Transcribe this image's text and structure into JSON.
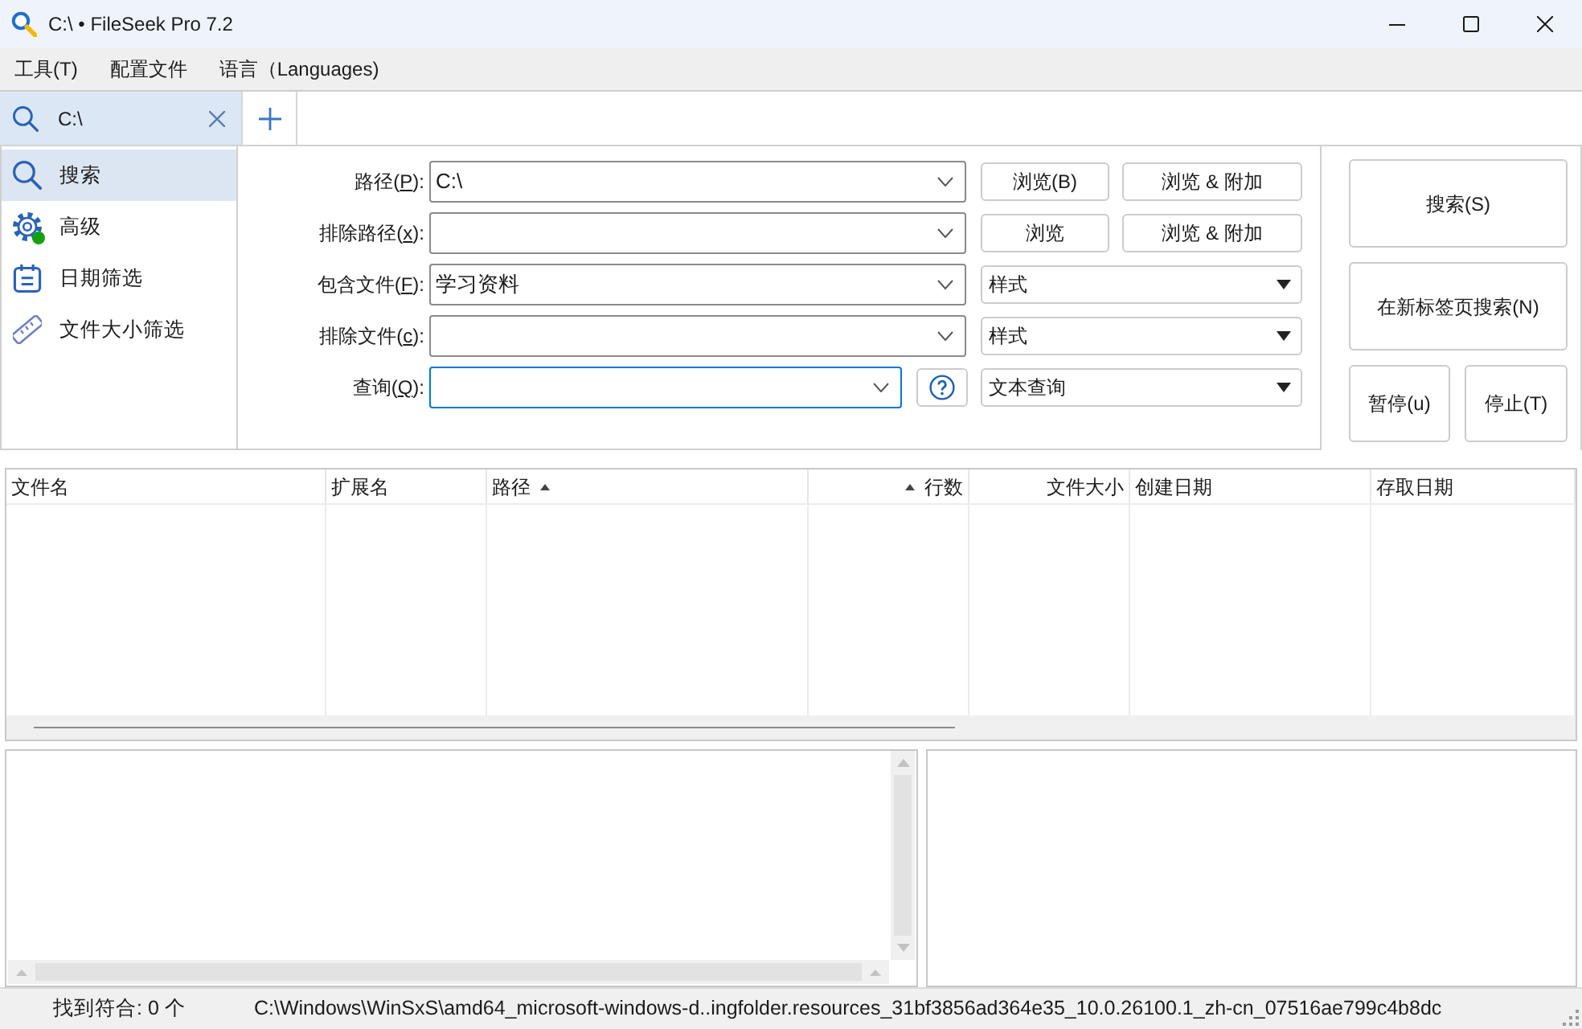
{
  "window": {
    "title": "C:\\ • FileSeek Pro 7.2"
  },
  "menu": [
    "工具(T)",
    "配置文件",
    "语言（Languages)"
  ],
  "tabs": [
    {
      "label": "C:\\",
      "selected": true
    }
  ],
  "sidebar": {
    "items": [
      {
        "label": "搜索",
        "selected": true,
        "indicator": false
      },
      {
        "label": "高级",
        "selected": false,
        "indicator": true
      },
      {
        "label": "日期筛选",
        "selected": false,
        "indicator": false
      },
      {
        "label": "文件大小筛选",
        "selected": false,
        "indicator": false
      }
    ]
  },
  "form": {
    "rows": [
      {
        "kind": "browse",
        "label": "路径(",
        "key": "P",
        "label_end": "):",
        "value": "C:\\",
        "focused": false,
        "buttons": [
          "浏览(B)",
          "浏览 & 附加"
        ]
      },
      {
        "kind": "browse",
        "label": "排除路径(",
        "key": "x",
        "label_end": "):",
        "focused": false,
        "buttons": [
          "浏览",
          "浏览 & 附加"
        ]
      },
      {
        "kind": "pattern",
        "label": "包含文件(",
        "key": "F",
        "label_end": "):",
        "value": "学习资料",
        "focused": false,
        "dropdown": "样式"
      },
      {
        "kind": "pattern",
        "label": "排除文件(",
        "key": "c",
        "label_end": "):",
        "focused": false,
        "dropdown": "样式"
      },
      {
        "kind": "query",
        "label": "查询(",
        "key": "Q",
        "label_end": "):",
        "focused": true,
        "dropdown": "文本查询"
      }
    ]
  },
  "actions": [
    "搜索(S)",
    "在新标签页搜索(N)",
    "暂停(u)",
    "停止(T)"
  ],
  "results": {
    "columns": [
      {
        "label": "文件名",
        "sorted": false
      },
      {
        "label": "扩展名",
        "sorted": false
      },
      {
        "label": "路径",
        "sorted": true
      },
      {
        "label": "行数",
        "sorted": true
      },
      {
        "label": "文件大小",
        "sorted": false
      },
      {
        "label": "创建日期",
        "sorted": false
      },
      {
        "label": "存取日期",
        "sorted": false
      }
    ]
  },
  "status_bar": {
    "match_count": "找到符合: 0 个",
    "current_path": "C:\\Windows\\WinSxS\\amd64_microsoft-windows-d..ingfolder.resources_31bf3856ad364e35_10.0.26100.1_zh-cn_07516ae799c4b8dc"
  }
}
